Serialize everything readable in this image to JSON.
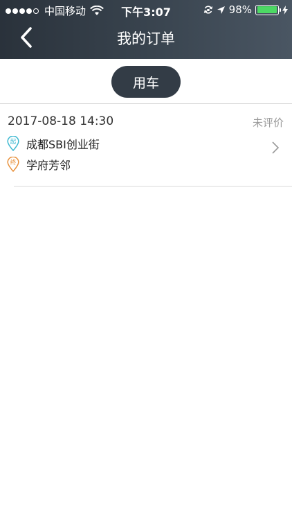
{
  "status_bar": {
    "carrier": "中国移动",
    "time": "下午3:07",
    "battery_percent": "98%",
    "battery_level": 0.98,
    "battery_color": "#4cd964",
    "signal_bars_filled": 4,
    "signal_bars_total": 5
  },
  "header": {
    "title": "我的订单",
    "back_icon": "chevron-left-icon"
  },
  "tabs": [
    {
      "label": "用车",
      "selected": true
    }
  ],
  "orders": [
    {
      "datetime": "2017-08-18 14:30",
      "status": "未评价",
      "start": {
        "badge": "起",
        "place": "成都SBI创业街",
        "color": "#3bb8d0"
      },
      "end": {
        "badge": "终",
        "place": "学府芳邻",
        "color": "#e8903a"
      }
    }
  ]
}
